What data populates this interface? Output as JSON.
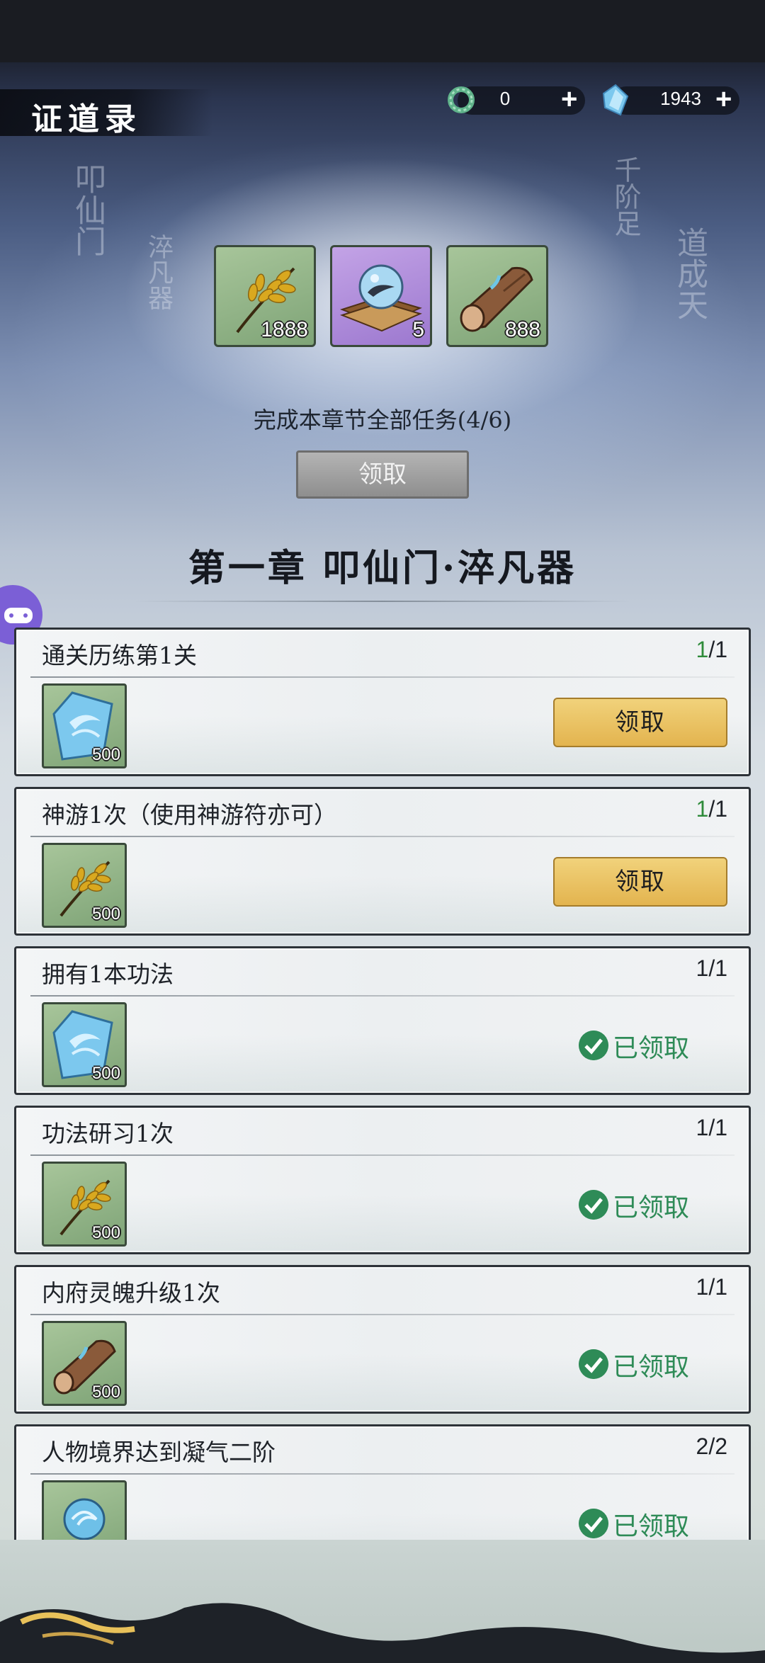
{
  "header": {
    "title": "证道录"
  },
  "currencies": [
    {
      "icon": "jade-ring-icon",
      "value": "0"
    },
    {
      "icon": "spirit-crystal-icon",
      "value": "1943"
    }
  ],
  "chapter_rewards": [
    {
      "icon": "golden-grain-icon",
      "count": "1888"
    },
    {
      "icon": "spirit-orb-scroll-icon",
      "count": "5"
    },
    {
      "icon": "spirit-wood-icon",
      "count": "888"
    }
  ],
  "progress_text": "完成本章节全部任务(4/6)",
  "claim_all_label": "领取",
  "chapter_title": "第一章 叩仙门·淬凡器",
  "tasks": [
    {
      "name": "通关历练第1关",
      "done": "1",
      "total": "/1",
      "reward_icon": "spirit-crystal-icon",
      "reward_count": "500",
      "state": "claim",
      "claim_label": "领取"
    },
    {
      "name": "神游1次（使用神游符亦可）",
      "done": "1",
      "total": "/1",
      "reward_icon": "golden-grain-icon",
      "reward_count": "500",
      "state": "claim",
      "claim_label": "领取"
    },
    {
      "name": "拥有1本功法",
      "done": "1",
      "total": "/1",
      "reward_icon": "spirit-crystal-icon",
      "reward_count": "500",
      "state": "claimed",
      "claimed_label": "已领取"
    },
    {
      "name": "功法研习1次",
      "done": "1",
      "total": "/1",
      "reward_icon": "golden-grain-icon",
      "reward_count": "500",
      "state": "claimed",
      "claimed_label": "已领取"
    },
    {
      "name": "内府灵魄升级1次",
      "done": "1",
      "total": "/1",
      "reward_icon": "spirit-wood-icon",
      "reward_count": "500",
      "state": "claimed",
      "claimed_label": "已领取"
    },
    {
      "name": "人物境界达到凝气二阶",
      "done": "2",
      "total": "/2",
      "reward_icon": "spirit-orb-icon",
      "reward_count": "",
      "state": "claimed",
      "claimed_label": "已领取"
    }
  ],
  "colors": {
    "claimed_green": "#2e8b57",
    "gold_button": "#e8bf5a",
    "progress_done": "#2e8b3a"
  }
}
